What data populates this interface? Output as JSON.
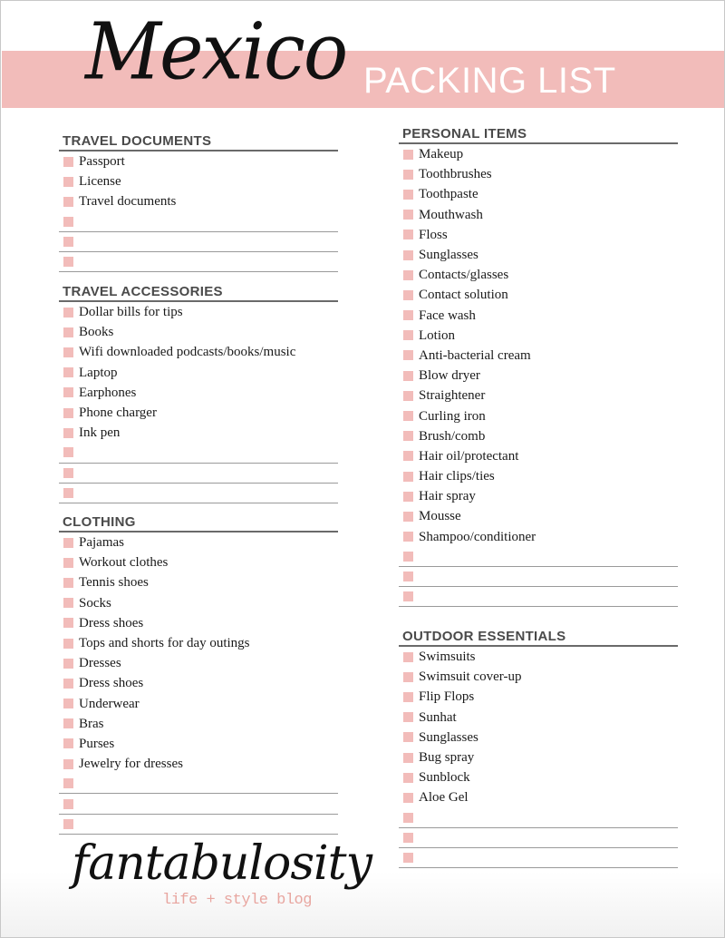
{
  "header": {
    "title_script": "Mexico",
    "title_block": "PACKING LIST",
    "accent_color": "#f2bcba"
  },
  "left_column": {
    "sections": [
      {
        "title": "TRAVEL DOCUMENTS",
        "items": [
          "Passport",
          "License",
          "Travel documents"
        ],
        "blank_lines": 3
      },
      {
        "title": "TRAVEL ACCESSORIES",
        "items": [
          "Dollar bills for tips",
          "Books",
          "Wifi downloaded podcasts/books/music",
          "Laptop",
          "Earphones",
          "Phone charger",
          "Ink pen"
        ],
        "blank_lines": 3
      },
      {
        "title": "CLOTHING",
        "items": [
          "Pajamas",
          "Workout clothes",
          "Tennis shoes",
          "Socks",
          "Dress shoes",
          "Tops and shorts for day outings",
          "Dresses",
          "Dress shoes",
          "Underwear",
          "Bras",
          "Purses",
          "Jewelry for dresses"
        ],
        "blank_lines": 3
      }
    ]
  },
  "right_column": {
    "sections": [
      {
        "title": "PERSONAL ITEMS",
        "items": [
          "Makeup",
          "Toothbrushes",
          "Toothpaste",
          "Mouthwash",
          "Floss",
          "Sunglasses",
          "Contacts/glasses",
          "Contact solution",
          "Face wash",
          "Lotion",
          "Anti-bacterial cream",
          "Blow dryer",
          "Straightener",
          "Curling iron",
          "Brush/comb",
          "Hair oil/protectant",
          "Hair clips/ties",
          "Hair spray",
          "Mousse",
          "Shampoo/conditioner"
        ],
        "blank_lines": 3
      },
      {
        "title": "OUTDOOR ESSENTIALS",
        "items": [
          "Swimsuits",
          "Swimsuit cover-up",
          "Flip Flops",
          "Sunhat",
          "Sunglasses",
          "Bug spray",
          "Sunblock",
          "Aloe Gel"
        ],
        "blank_lines": 3
      }
    ]
  },
  "footer": {
    "logo_text": "fantabulosity",
    "tagline": "life + style blog",
    "tagline_color": "#e8a6a0"
  }
}
